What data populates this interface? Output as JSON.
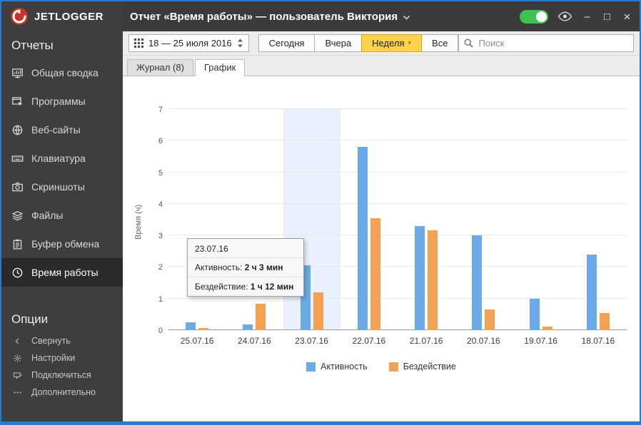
{
  "window": {
    "title": "Отчет «Время работы» — пользователь Виктория",
    "controls": {
      "minimize_glyph": "–",
      "maximize_glyph": "□",
      "close_glyph": "×"
    }
  },
  "sidebar": {
    "logo_text": "JETLOGGER",
    "sections": [
      {
        "label": "Отчеты",
        "items": [
          {
            "id": "summary",
            "label": "Общая сводка",
            "icon": "summary-icon"
          },
          {
            "id": "programs",
            "label": "Программы",
            "icon": "programs-icon"
          },
          {
            "id": "websites",
            "label": "Веб-сайты",
            "icon": "websites-icon"
          },
          {
            "id": "keyboard",
            "label": "Клавиатура",
            "icon": "keyboard-icon"
          },
          {
            "id": "screenshots",
            "label": "Скриншоты",
            "icon": "screenshots-icon"
          },
          {
            "id": "files",
            "label": "Файлы",
            "icon": "files-icon"
          },
          {
            "id": "clipboard",
            "label": "Буфер обмена",
            "icon": "clipboard-icon"
          },
          {
            "id": "worktime",
            "label": "Время работы",
            "icon": "worktime-icon",
            "active": true
          }
        ]
      },
      {
        "label": "Опции",
        "items": [
          {
            "id": "collapse",
            "label": "Свернуть",
            "icon": "collapse-icon"
          },
          {
            "id": "settings",
            "label": "Настройки",
            "icon": "settings-icon"
          },
          {
            "id": "connect",
            "label": "Подключиться",
            "icon": "connect-icon"
          },
          {
            "id": "more",
            "label": "Дополнительно",
            "icon": "more-icon"
          }
        ]
      }
    ]
  },
  "toolbar": {
    "date_range": "18 — 25 июля 2016",
    "filters": [
      {
        "id": "today",
        "label": "Сегодня"
      },
      {
        "id": "yesterday",
        "label": "Вчера"
      },
      {
        "id": "week",
        "label": "Неделя",
        "active": true,
        "caret": "▾"
      },
      {
        "id": "all",
        "label": "Все"
      }
    ],
    "search_placeholder": "Поиск"
  },
  "tabs": [
    {
      "id": "journal",
      "label": "Журнал (8)"
    },
    {
      "id": "chart",
      "label": "График",
      "active": true
    }
  ],
  "tooltip": {
    "date": "23.07.16",
    "activity_label": "Активность:",
    "activity_value": "2 ч 3 мин",
    "idle_label": "Бездействие:",
    "idle_value": "1 ч 12 мин"
  },
  "chart_data": {
    "type": "bar",
    "categories": [
      "25.07.16",
      "24.07.16",
      "23.07.16",
      "22.07.16",
      "21.07.16",
      "20.07.16",
      "19.07.16",
      "18.07.16"
    ],
    "series": [
      {
        "name": "Активность",
        "color": "#6babe5",
        "values": [
          0.25,
          0.17,
          2.05,
          5.8,
          3.3,
          3.0,
          1.0,
          2.4
        ]
      },
      {
        "name": "Бездействие",
        "color": "#f3a254",
        "values": [
          0.07,
          0.83,
          1.2,
          3.55,
          3.17,
          0.65,
          0.12,
          0.55
        ]
      }
    ],
    "ylabel": "Время (ч)",
    "ylim": [
      0,
      7
    ],
    "yticks": [
      0,
      1,
      2,
      3,
      4,
      5,
      6,
      7
    ],
    "highlighted_category": "23.07.16",
    "legend_position": "bottom",
    "grid": true
  }
}
